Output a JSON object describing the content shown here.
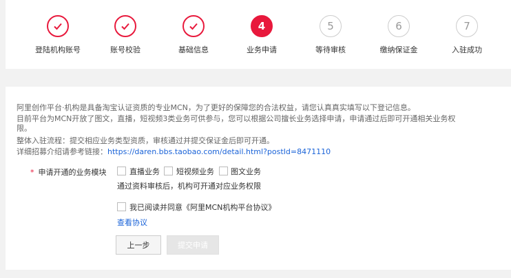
{
  "steps": [
    {
      "label": "登陆机构账号",
      "state": "done"
    },
    {
      "label": "账号校验",
      "state": "done"
    },
    {
      "label": "基础信息",
      "state": "done"
    },
    {
      "label": "业务申请",
      "state": "active",
      "number": "4"
    },
    {
      "label": "等待审核",
      "state": "todo",
      "number": "5"
    },
    {
      "label": "缴纳保证金",
      "state": "todo",
      "number": "6"
    },
    {
      "label": "入驻成功",
      "state": "todo",
      "number": "7"
    }
  ],
  "intro": {
    "line1": "阿里创作平台·机构是具备淘宝认证资质的专业MCN，为了更好的保障您的合法权益，请您认真真实填写以下登记信息。",
    "line2": "目前平台为MCN开放了图文，直播，短视频3类业务可供参与，您可以根据公司擅长业务选择申请，申请通过后即可开通相关业务权限。",
    "line3": "整体入驻流程：提交相应业务类型资质，审核通过并提交保证金后即可开通。",
    "line4_prefix": "详细招募介绍请参考链接：",
    "line4_link": "https://daren.bbs.taobao.com/detail.html?postId=8471110"
  },
  "business": {
    "label": "申请开通的业务模块",
    "required_mark": "*",
    "options": [
      "直播业务",
      "短视频业务",
      "图文业务"
    ],
    "hint": "通过资料审核后，机构可开通对应业务权限"
  },
  "agreement": {
    "text": "我已阅读并同意《阿里MCN机构平台协议》",
    "link": "查看协议"
  },
  "buttons": {
    "prev": "上一步",
    "submit": "提交申请"
  },
  "colors": {
    "accent": "#e8193c",
    "link": "#1a63d8"
  }
}
